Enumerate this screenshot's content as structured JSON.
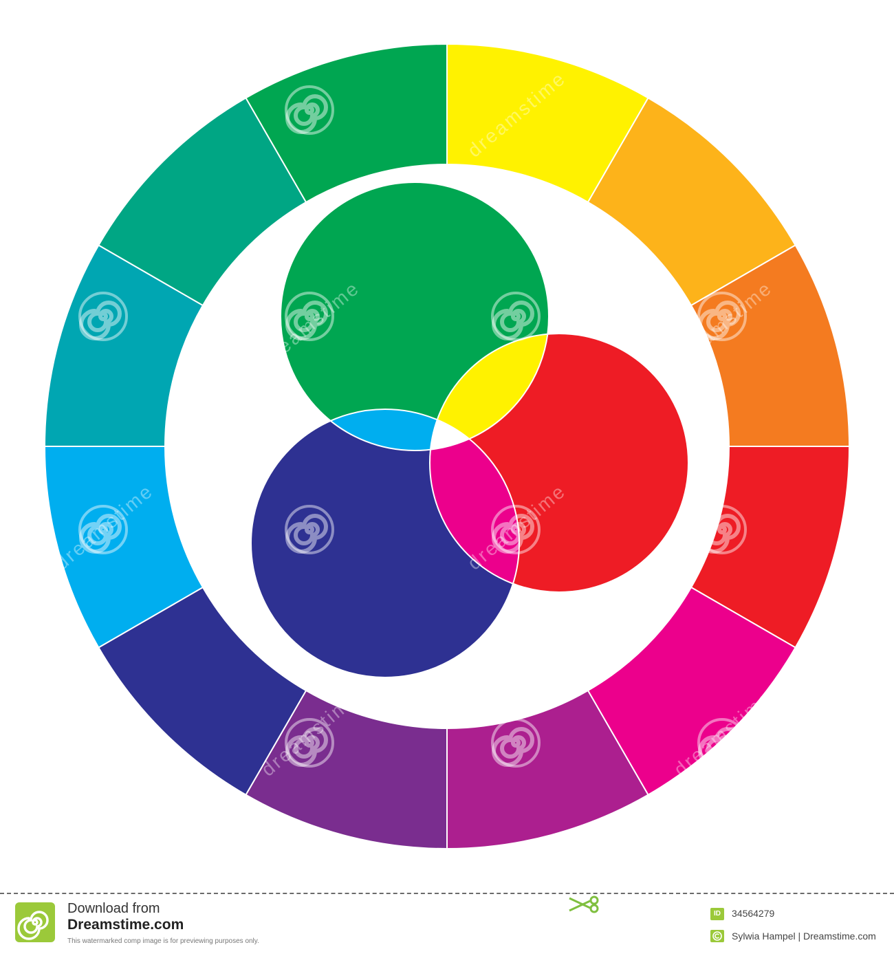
{
  "wheel": {
    "segments": [
      {
        "color": "#fff200"
      },
      {
        "color": "#fdb31a"
      },
      {
        "color": "#f47b20"
      },
      {
        "color": "#ee1c25"
      },
      {
        "color": "#ec008c"
      },
      {
        "color": "#ac1f8f"
      },
      {
        "color": "#7a2d8f"
      },
      {
        "color": "#2e3192"
      },
      {
        "color": "#00aeef"
      },
      {
        "color": "#00a6b2"
      },
      {
        "color": "#00a684"
      },
      {
        "color": "#00a651"
      }
    ]
  },
  "venn": {
    "green": "#00a651",
    "red": "#ee1c25",
    "blue": "#2e3192",
    "yellow": "#fff200",
    "cyan": "#00aeef",
    "magenta": "#ec008c",
    "white": "#ffffff"
  },
  "watermark": {
    "text": "dreamstime"
  },
  "footer": {
    "download_from": "Download from",
    "site": "Dreamstime.com",
    "note": "This watermarked comp image is for previewing purposes only.",
    "id_label": "ID",
    "id_number": "34564279",
    "author": "Sylwia Hampel | Dreamstime.com",
    "accent": "#9bc93a"
  }
}
